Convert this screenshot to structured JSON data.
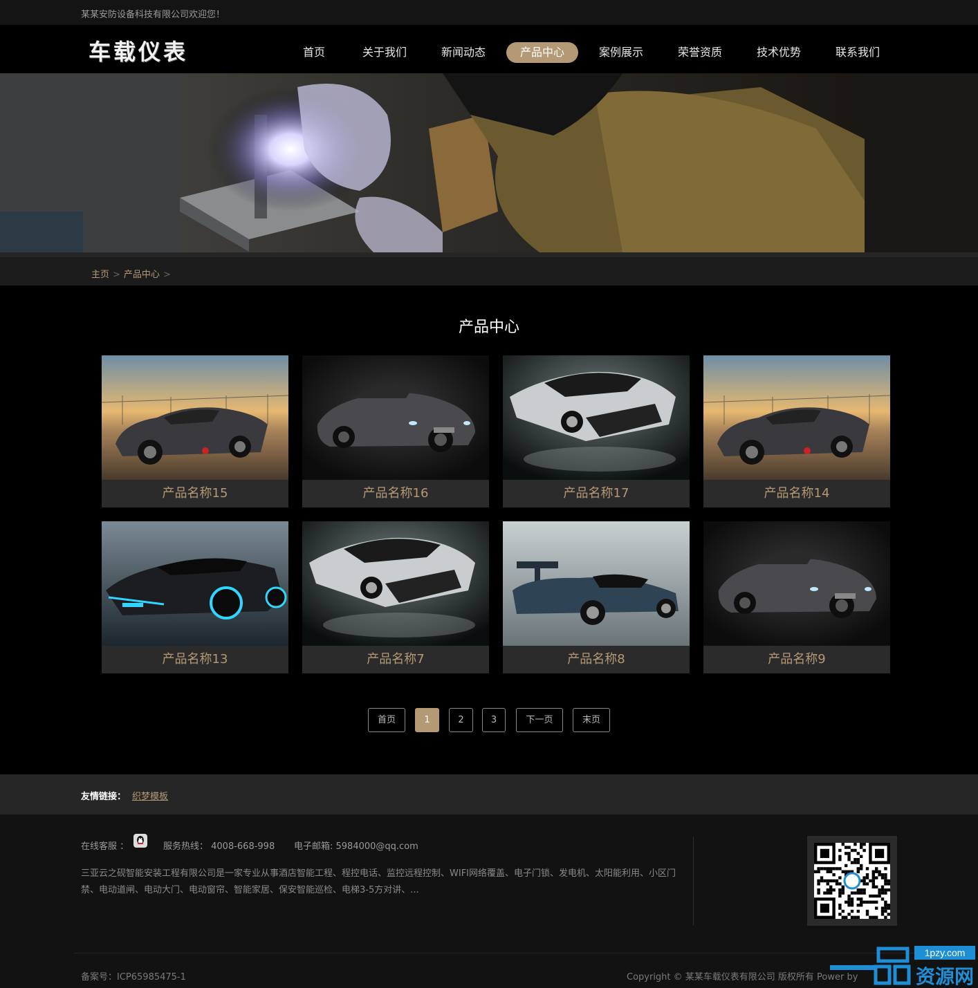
{
  "topbar": {
    "welcome": "某某安防设备科技有限公司欢迎您！"
  },
  "header": {
    "logo": "车载仪表",
    "nav": [
      {
        "label": "首页",
        "active": false
      },
      {
        "label": "关于我们",
        "active": false
      },
      {
        "label": "新闻动态",
        "active": false
      },
      {
        "label": "产品中心",
        "active": true
      },
      {
        "label": "案例展示",
        "active": false
      },
      {
        "label": "荣誉资质",
        "active": false
      },
      {
        "label": "技术优势",
        "active": false
      },
      {
        "label": "联系我们",
        "active": false
      }
    ]
  },
  "breadcrumb": {
    "home": "主页",
    "sep": ">",
    "current": "产品中心",
    "trail": ">"
  },
  "section": {
    "title": "产品中心"
  },
  "products": [
    {
      "name": "产品名称15",
      "image": "dusk-sports-car"
    },
    {
      "name": "产品名称16",
      "image": "dark-concept-car"
    },
    {
      "name": "产品名称17",
      "image": "silver-supercar"
    },
    {
      "name": "产品名称14",
      "image": "dusk-sports-car"
    },
    {
      "name": "产品名称13",
      "image": "neon-supercar"
    },
    {
      "name": "产品名称7",
      "image": "silver-supercar"
    },
    {
      "name": "产品名称8",
      "image": "race-car"
    },
    {
      "name": "产品名称9",
      "image": "dark-concept-car"
    }
  ],
  "pagination": {
    "first": "首页",
    "pages": [
      "1",
      "2",
      "3"
    ],
    "current": "1",
    "next": "下一页",
    "last": "末页"
  },
  "friend_links": {
    "label": "友情链接：",
    "links": [
      "织梦模板"
    ]
  },
  "footer": {
    "online_label": "在线客服 ：",
    "hotline": "服务热线： 4008-668-998",
    "email": "电子邮箱: 5984000@qq.com",
    "description": "三亚云之砚智能安装工程有限公司是一家专业从事酒店智能工程、程控电话、监控远程控制、WIFI网络覆盖、电子门锁、发电机、太阳能利用、小区门禁、电动道闸、电动大门、电动窗帘、智能家居、保安智能巡检、电梯3-5方对讲、...",
    "icp": "备案号：ICP65985475-1",
    "copyright": "Copyright © 某某车载仪表有限公司 版权所有 Power by"
  },
  "watermark": {
    "text": "资源网",
    "domain": "1pzy.com"
  },
  "colors": {
    "accent": "#b49a74",
    "background": "#000000",
    "card": "#2b2b2b"
  }
}
